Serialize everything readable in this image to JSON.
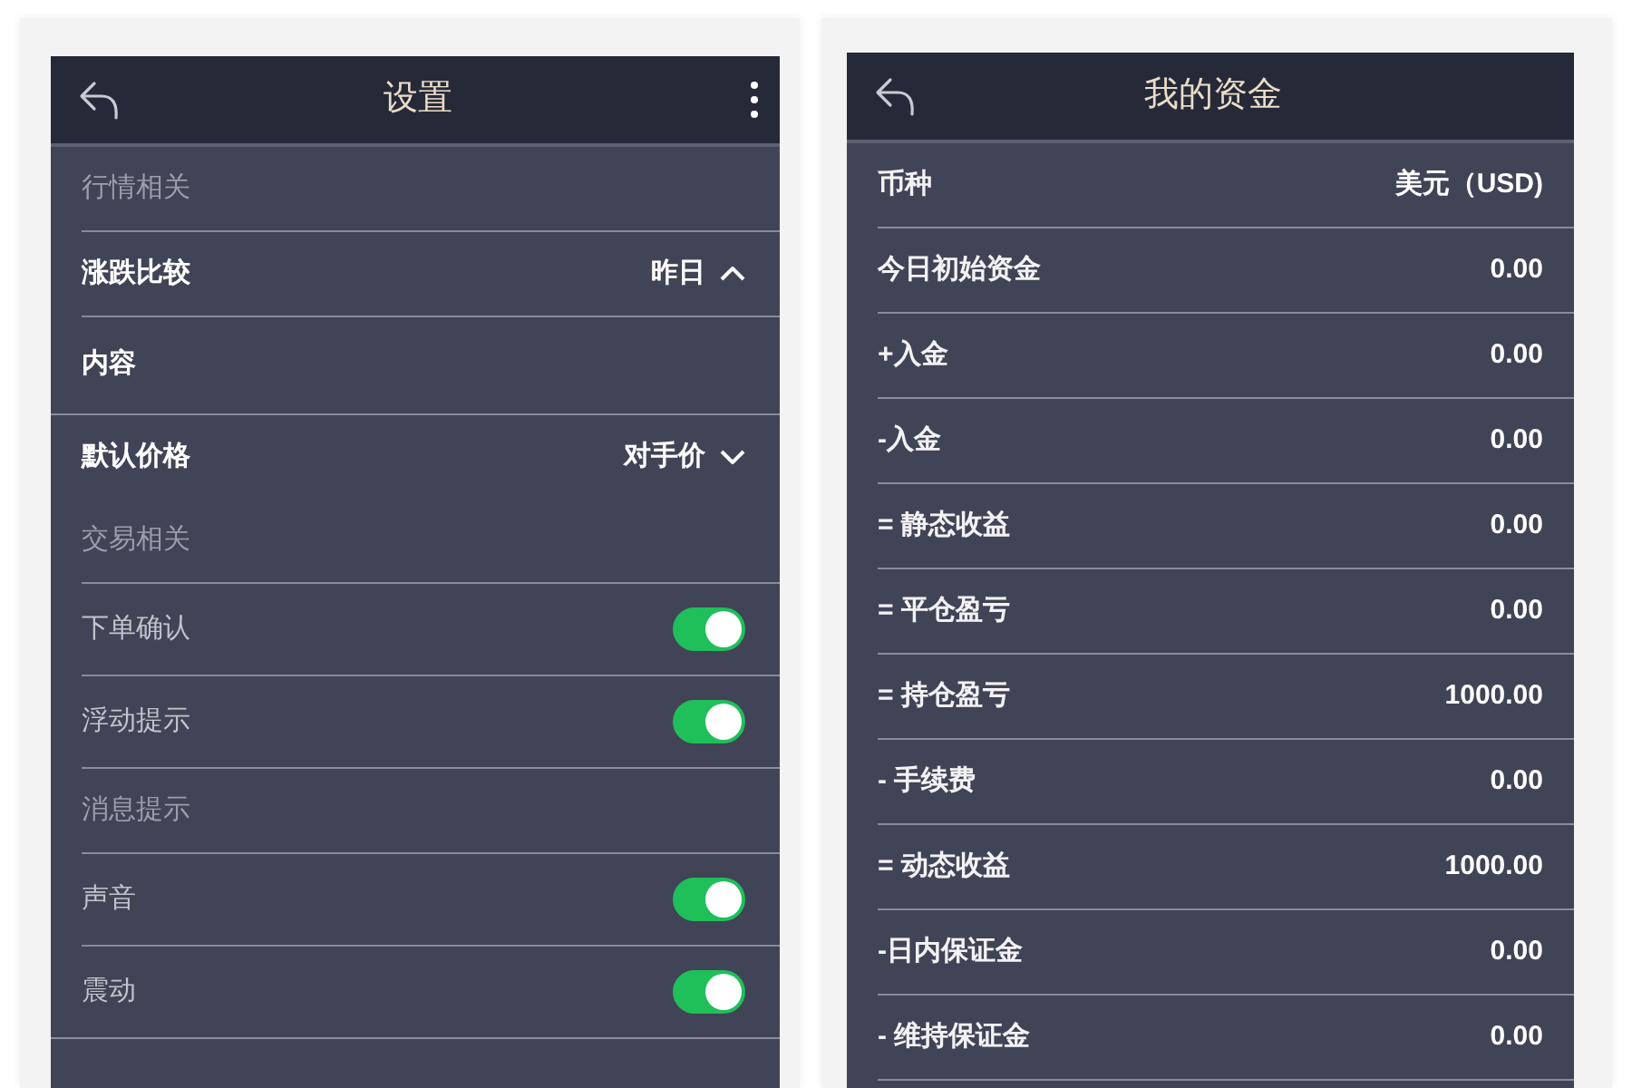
{
  "settings": {
    "title": "设置",
    "groups": [
      {
        "heading": "行情相关",
        "rows": [
          {
            "kind": "select",
            "label": "涨跌比较",
            "value": "昨日",
            "expanded": true
          },
          {
            "kind": "item",
            "label": "内容"
          }
        ]
      },
      {
        "rows": [
          {
            "kind": "select",
            "label": "默认价格",
            "value": "对手价",
            "expanded": false
          }
        ]
      },
      {
        "heading": "交易相关",
        "rows": [
          {
            "kind": "toggle",
            "label": "下单确认",
            "on": true
          },
          {
            "kind": "toggle",
            "label": "浮动提示",
            "on": true
          },
          {
            "kind": "subheading",
            "label": "消息提示"
          },
          {
            "kind": "toggle",
            "label": "声音",
            "on": true
          },
          {
            "kind": "toggle",
            "label": "震动",
            "on": true
          }
        ]
      }
    ]
  },
  "funds": {
    "title": "我的资金",
    "rows": [
      {
        "label": "币种",
        "value": "美元（USD)"
      },
      {
        "label": "今日初始资金",
        "value": "0.00"
      },
      {
        "label": "+入金",
        "value": "0.00"
      },
      {
        "label": "-入金",
        "value": "0.00"
      },
      {
        "label": "= 静态收益",
        "value": "0.00"
      },
      {
        "label": "= 平仓盈亏",
        "value": "0.00"
      },
      {
        "label": "= 持仓盈亏",
        "value": "1000.00"
      },
      {
        "label": "- 手续费",
        "value": "0.00"
      },
      {
        "label": "= 动态收益",
        "value": "1000.00"
      },
      {
        "label": "-日内保证金",
        "value": "0.00"
      },
      {
        "label": "- 维持保证金",
        "value": "0.00"
      }
    ]
  }
}
